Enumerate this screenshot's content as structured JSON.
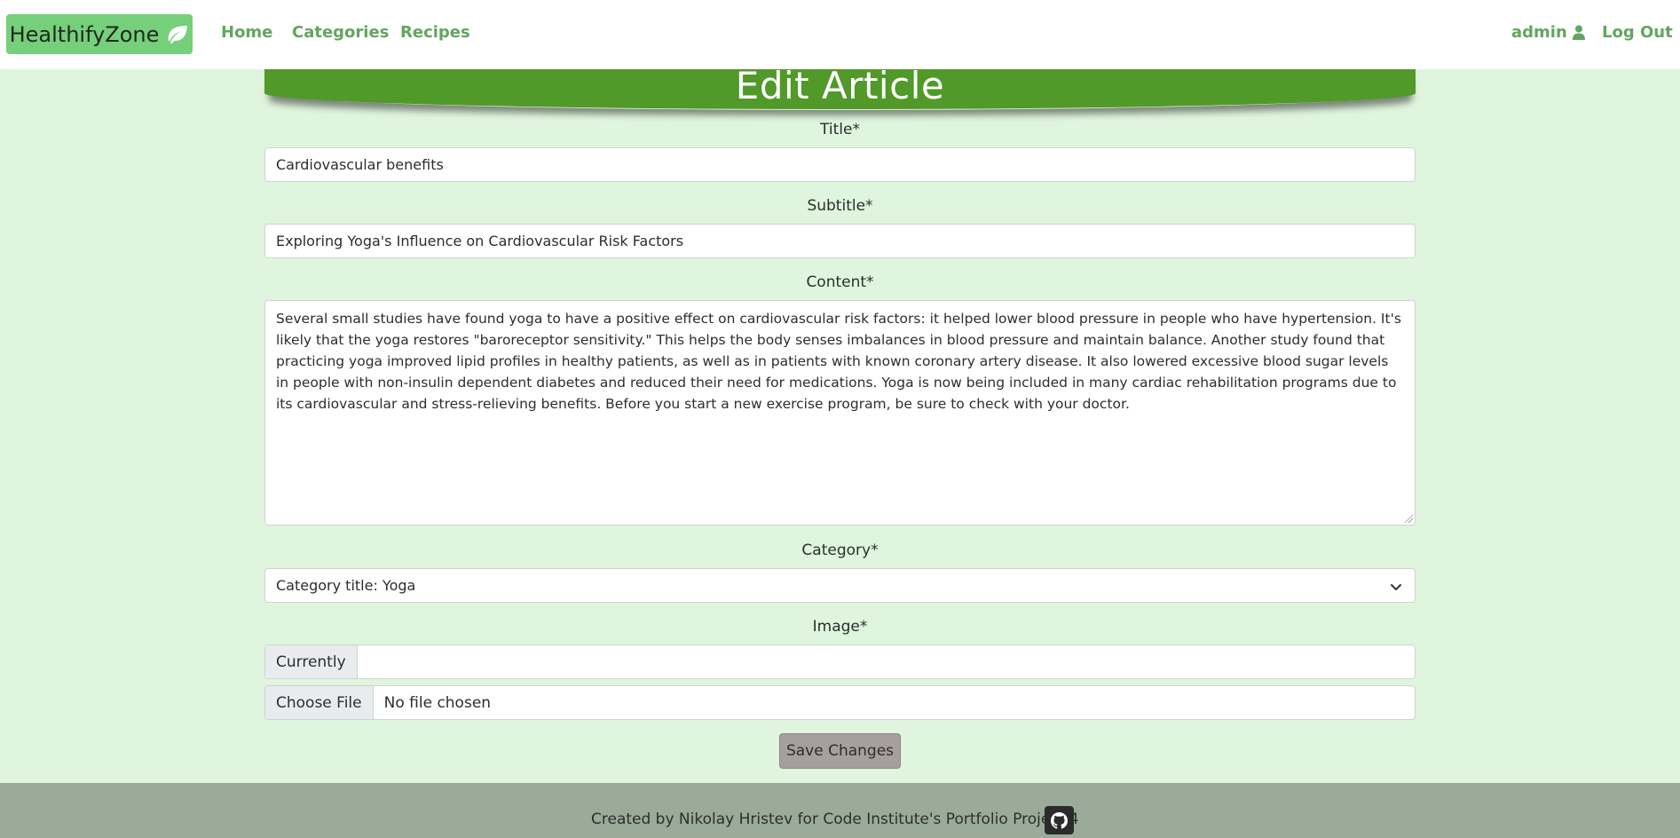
{
  "nav": {
    "brand": "HealthifyZone",
    "home": "Home",
    "categories": "Categories",
    "recipes": "Recipes",
    "user": "admin",
    "logout": "Log Out"
  },
  "page": {
    "title": "Edit Article"
  },
  "form": {
    "title_label": "Title*",
    "title_value": "Cardiovascular benefits",
    "subtitle_label": "Subtitle*",
    "subtitle_value": "Exploring Yoga's Influence on Cardiovascular Risk Factors",
    "content_label": "Content*",
    "content_value": "Several small studies have found yoga to have a positive effect on cardiovascular risk factors: it helped lower blood pressure in people who have hypertension. It's likely that the yoga restores \"baroreceptor sensitivity.\" This helps the body senses imbalances in blood pressure and maintain balance. Another study found that practicing yoga improved lipid profiles in healthy patients, as well as in patients with known coronary artery disease. It also lowered excessive blood sugar levels in people with non-insulin dependent diabetes and reduced their need for medications. Yoga is now being included in many cardiac rehabilitation programs due to its cardiovascular and stress-relieving benefits. Before you start a new exercise program, be sure to check with your doctor.",
    "category_label": "Category*",
    "category_value": "Category title: Yoga",
    "image_label": "Image*",
    "currently_label": "Currently",
    "currently_value": "",
    "choose_file_label": "Choose File",
    "file_status": "No file chosen",
    "save_label": "Save Changes"
  },
  "footer": {
    "text": "Created by Nikolay Hristev for Code Institute's Portfolio Project 4",
    "github_icon": "github-icon"
  },
  "colors": {
    "brand_bg": "#76cf7a",
    "nav_link": "#62a55f",
    "page_bg": "#dff5dd",
    "banner": "#519928",
    "save_button": "#a79e9e",
    "footer_bg": "#9aab99"
  }
}
